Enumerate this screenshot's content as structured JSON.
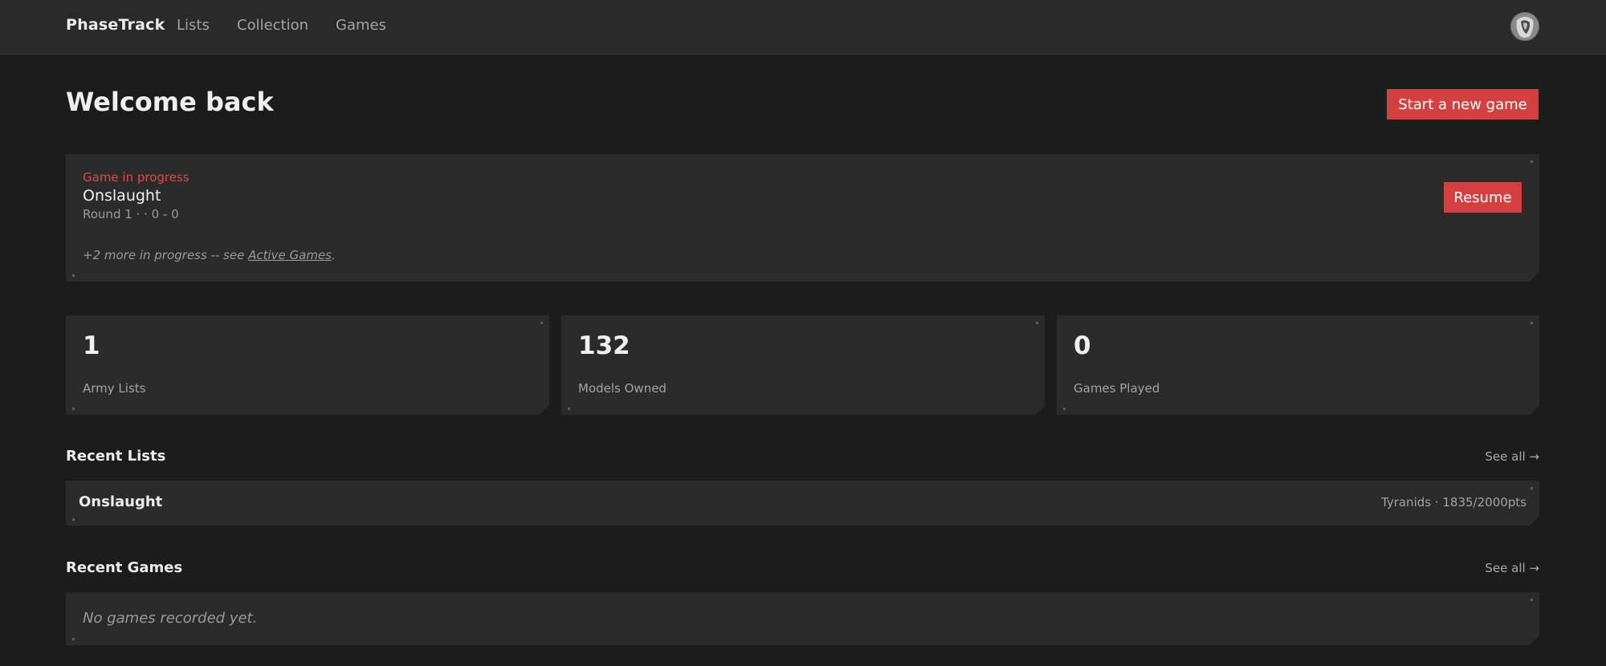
{
  "nav": {
    "brand": "PhaseTrack",
    "links": [
      "Lists",
      "Collection",
      "Games"
    ]
  },
  "header": {
    "title": "Welcome back",
    "new_game_label": "Start a new game"
  },
  "game_in_progress": {
    "label": "Game in progress",
    "title": "Onslaught",
    "meta": "Round 1 · · 0 - 0",
    "resume_label": "Resume",
    "more_prefix": "+2 more in progress -- see ",
    "more_link": "Active Games",
    "more_suffix": "."
  },
  "stats": [
    {
      "value": "1",
      "label": "Army Lists"
    },
    {
      "value": "132",
      "label": "Models Owned"
    },
    {
      "value": "0",
      "label": "Games Played"
    }
  ],
  "recent_lists": {
    "title": "Recent Lists",
    "see_all": "See all →",
    "items": [
      {
        "name": "Onslaught",
        "meta": "Tyranids · 1835/2000pts"
      }
    ]
  },
  "recent_games": {
    "title": "Recent Games",
    "see_all": "See all →",
    "empty_message": "No games recorded yet."
  },
  "colors": {
    "background": "#1c1c1c",
    "card": "#2b2b2b",
    "accent_red": "#d4403f"
  }
}
